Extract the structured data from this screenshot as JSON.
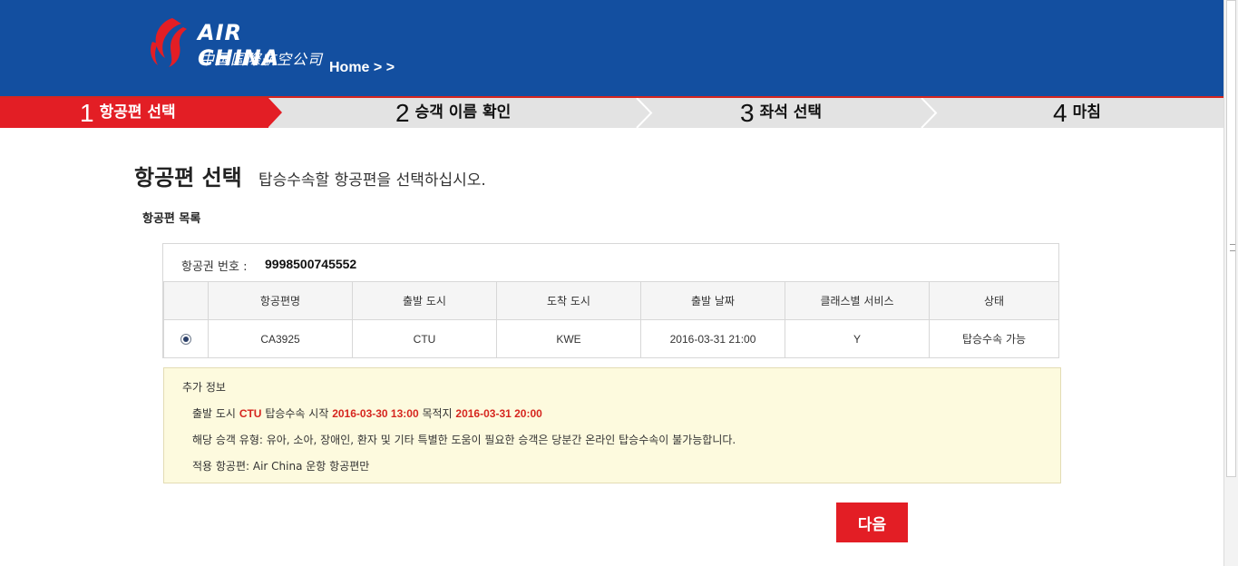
{
  "header": {
    "logo_text": "AIR CHINA",
    "logo_sub": "中国国際航空公司",
    "breadcrumb": "Home > >"
  },
  "steps": [
    {
      "num": "1",
      "label": "항공편 선택",
      "active": true
    },
    {
      "num": "2",
      "label": "승객 이름 확인",
      "active": false
    },
    {
      "num": "3",
      "label": "좌석 선택",
      "active": false
    },
    {
      "num": "4",
      "label": "마침",
      "active": false
    }
  ],
  "page": {
    "title": "항공편 선택",
    "subtitle": "탑승수속할 항공편을 선택하십시오.",
    "section_title": "항공편 목록"
  },
  "ticket": {
    "label": "항공권 번호 :",
    "number": "9998500745552"
  },
  "table": {
    "headers": [
      "항공편명",
      "출발 도시",
      "도착 도시",
      "출발 날짜",
      "클래스별 서비스",
      "상태"
    ],
    "rows": [
      {
        "selected": true,
        "flight": "CA3925",
        "from": "CTU",
        "to": "KWE",
        "date": "2016-03-31 21:00",
        "class": "Y",
        "status": "탑승수속 가능"
      }
    ]
  },
  "info": {
    "title": "추가 정보",
    "line1_prefix": "출발 도시",
    "line1_city": "CTU",
    "line1_mid": "탑승수속 시작",
    "line1_start": "2016-03-30 13:00",
    "line1_mid2": "목적지",
    "line1_end": "2016-03-31 20:00",
    "line2": "해당 승객 유형: 유아, 소아, 장애인, 환자 및 기타 특별한 도움이 필요한 승객은 당분간 온라인 탑승수속이 불가능합니다.",
    "line3": "적용 항공편: Air China 운항 항공편만"
  },
  "next_button": "다음",
  "colors": {
    "header_blue": "#134fa0",
    "accent_red": "#e31e25",
    "info_bg": "#fdfade"
  }
}
